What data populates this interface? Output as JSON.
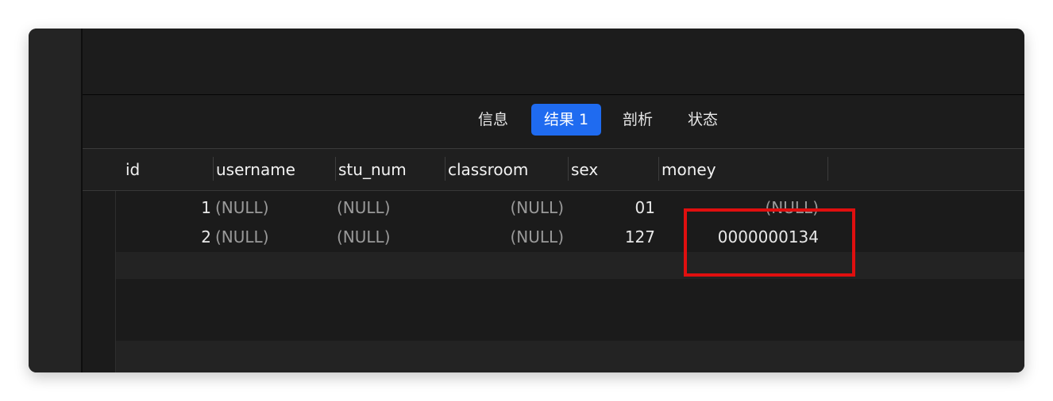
{
  "tabs": [
    {
      "label": "信息",
      "active": false
    },
    {
      "label": "结果 1",
      "active": true
    },
    {
      "label": "剖析",
      "active": false
    },
    {
      "label": "状态",
      "active": false
    }
  ],
  "columns": [
    "id",
    "username",
    "stu_num",
    "classroom",
    "sex",
    "money"
  ],
  "rows": [
    {
      "id": "1",
      "username": "(NULL)",
      "stu_num": "(NULL)",
      "classroom": "(NULL)",
      "sex": "01",
      "money": "(NULL)"
    },
    {
      "id": "2",
      "username": "(NULL)",
      "stu_num": "(NULL)",
      "classroom": "(NULL)",
      "sex": "127",
      "money": "0000000134"
    }
  ],
  "colors": {
    "accent": "#1f6bf0",
    "highlight": "#e00f0f",
    "background": "#1b1b1b",
    "null_text": "#9a9a9a"
  }
}
